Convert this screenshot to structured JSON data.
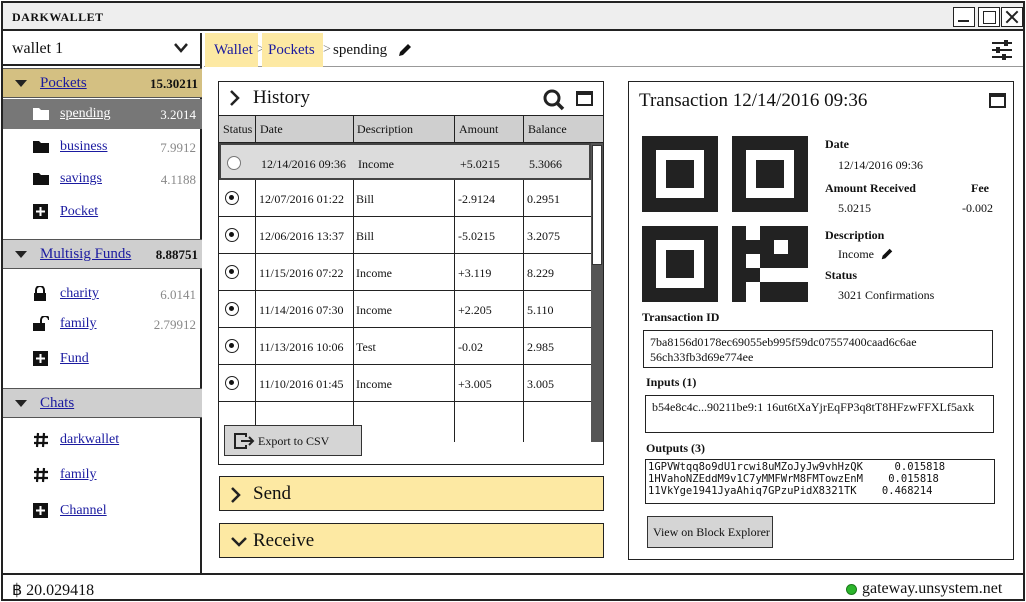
{
  "titlebar": {
    "title": "DARKWALLET"
  },
  "wallet": {
    "name": "wallet 1"
  },
  "sidebar": {
    "pockets": {
      "label": "Pockets",
      "amount": "15.30211"
    },
    "pocket_items": [
      {
        "label": "spending",
        "amount": "3.2014",
        "icon": "folder-icon"
      },
      {
        "label": "business",
        "amount": "7.9912",
        "icon": "folder-icon"
      },
      {
        "label": "savings",
        "amount": "4.1188",
        "icon": "folder-icon"
      },
      {
        "label": "Pocket",
        "amount": "",
        "icon": "plus-square-icon"
      }
    ],
    "multisig": {
      "label": "Multisig Funds",
      "amount": "8.88751"
    },
    "multisig_items": [
      {
        "label": "charity",
        "amount": "6.0141",
        "icon": "lock-icon"
      },
      {
        "label": "family",
        "amount": "2.79912",
        "icon": "unlock-icon"
      },
      {
        "label": "Fund",
        "amount": "",
        "icon": "plus-square-icon"
      }
    ],
    "chats": {
      "label": "Chats"
    },
    "chat_items": [
      {
        "label": "darkwallet",
        "icon": "hash-icon"
      },
      {
        "label": "family",
        "icon": "hash-icon"
      },
      {
        "label": "Channel",
        "icon": "plus-square-icon"
      }
    ]
  },
  "breadcrumb": {
    "items": [
      "Wallet",
      "Pockets",
      "spending"
    ],
    "separator": ">"
  },
  "history": {
    "title": "History",
    "columns": [
      "Status",
      "Date",
      "Description",
      "Amount",
      "Balance"
    ],
    "rows": [
      {
        "status": "pending",
        "date": "12/14/2016 09:36",
        "description": "Income",
        "amount": "+5.0215",
        "balance": "5.3066"
      },
      {
        "status": "confirmed",
        "date": "12/07/2016 01:22",
        "description": "Bill",
        "amount": "-2.9124",
        "balance": "0.2951"
      },
      {
        "status": "confirmed",
        "date": "12/06/2016 13:37",
        "description": "Bill",
        "amount": "-5.0215",
        "balance": "3.2075"
      },
      {
        "status": "confirmed",
        "date": "11/15/2016 07:22",
        "description": "Income",
        "amount": "+3.119",
        "balance": "8.229"
      },
      {
        "status": "confirmed",
        "date": "11/14/2016 07:30",
        "description": "Income",
        "amount": "+2.205",
        "balance": "5.110"
      },
      {
        "status": "confirmed",
        "date": "11/13/2016 10:06",
        "description": "Test",
        "amount": "-0.02",
        "balance": "2.985"
      },
      {
        "status": "confirmed",
        "date": "11/10/2016 01:45",
        "description": "Income",
        "amount": "+3.005",
        "balance": "3.005"
      }
    ],
    "export_label": "Export to CSV"
  },
  "send": {
    "label": "Send"
  },
  "receive": {
    "label": "Receive"
  },
  "transaction": {
    "title": "Transaction 12/14/2016 09:36",
    "date_label": "Date",
    "date": "12/14/2016 09:36",
    "amount_label": "Amount Received",
    "amount": "5.0215",
    "fee_label": "Fee",
    "fee": "-0.002",
    "description_label": "Description",
    "description": "Income",
    "status_label": "Status",
    "status": "3021 Confirmations",
    "txid_label": "Transaction ID",
    "txid": "7ba8156d0178ec69055eb995f59dc07557400caad6c6ae 56ch33fb3d69e774ee",
    "inputs_label": "Inputs (1)",
    "inputs": "b54e8c4c...90211be9:1 16ut6tXaYjrEqFP3q8tT8HFzwFFXLf5axk",
    "outputs_label": "Outputs (3)",
    "outputs": [
      {
        "address": "1GPVWtqq8o9dU1rcwi8uMZoJyJw9vhHzQK",
        "amount": "0.015818"
      },
      {
        "address": "1HVahoNZEddM9v1C7yMMFWrM8FMTowzEnM",
        "amount": "0.015818"
      },
      {
        "address": "11VkYge1941JyaAhiq7GPzuPidX8321TK",
        "amount": "0.468214"
      }
    ],
    "explorer_label": "View on Block Explorer"
  },
  "statusbar": {
    "balance": "฿ 20.029418",
    "gateway": "gateway.unsystem.net",
    "status_color": "#2bb52b"
  },
  "colors": {
    "accent": "#fde9a3",
    "section_active": "#d4c082",
    "link": "#1a1aa0"
  }
}
